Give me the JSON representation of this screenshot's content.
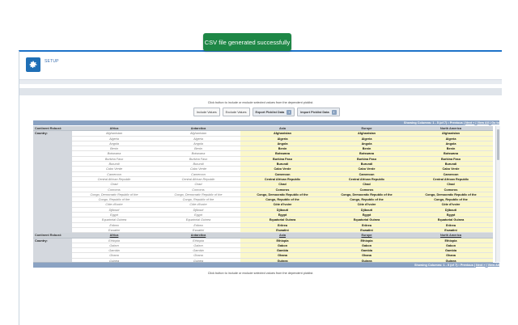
{
  "app": {
    "section_label": "SETUP"
  },
  "toast": {
    "message": "CSV file generated successfully"
  },
  "instructions": {
    "top": "Click button to include or exclude selected values from the dependent picklist.",
    "bottom": "Click button to include or exclude selected values from the dependent picklist."
  },
  "buttons": {
    "include": "Include Values",
    "exclude": "Exclude Values",
    "export": "Export Picklist Data",
    "import": "Import Picklist Data",
    "info_glyph": "i"
  },
  "pager_top": {
    "showing": "Showing Columns: 1 - 5 (of 7) • Previous |",
    "next": "Next »",
    "view_all": "View All",
    "go_to": "Go to"
  },
  "pager_bottom": {
    "showing": "Showing Columns: 1 - 5 (of 7) • Previous |",
    "next": "Next »",
    "view_all": "View All"
  },
  "grid": {
    "controlling_label": "Continent Robust:",
    "dependent_label": "Country:",
    "columns": [
      "Africa",
      "Antarctica",
      "Asia",
      "Europe",
      "North America"
    ],
    "included": [
      false,
      false,
      true,
      true,
      true
    ],
    "group1": [
      "Afghanistan",
      "Algeria",
      "Angola",
      "Benin",
      "Botswana",
      "Burkina Faso",
      "Burundi",
      "Cabo Verde",
      "Cameroon",
      "Central African Republic",
      "Chad",
      "Comoros",
      "Congo, Democratic Republic of the",
      "Congo, Republic of the",
      "Côte d'Ivoire",
      "Djibouti",
      "Egypt",
      "Equatorial Guinea",
      "Eritrea",
      "Eswatini"
    ],
    "group2": [
      "Ethiopia",
      "Gabon",
      "Gambia",
      "Ghana",
      "Guinea"
    ]
  }
}
